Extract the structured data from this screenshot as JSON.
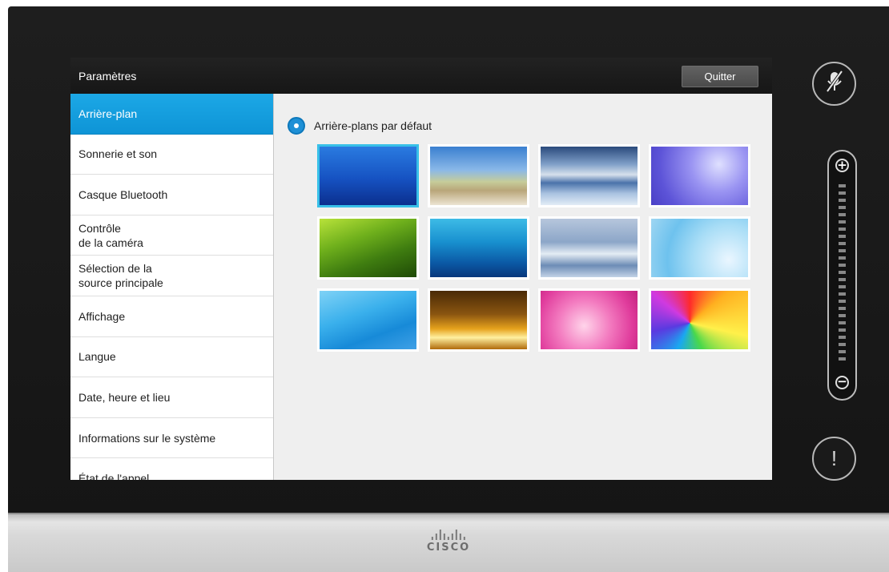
{
  "window": {
    "title": "Paramètres",
    "quit_label": "Quitter"
  },
  "sidebar": {
    "items": [
      {
        "label": "Arrière-plan",
        "active": true
      },
      {
        "label": "Sonnerie et son"
      },
      {
        "label": "Casque Bluetooth"
      },
      {
        "label": "Contrôle\nde la caméra"
      },
      {
        "label": "Sélection de la\nsource principale"
      },
      {
        "label": "Affichage"
      },
      {
        "label": "Langue"
      },
      {
        "label": "Date, heure et lieu"
      },
      {
        "label": "Informations sur le système"
      },
      {
        "label": "État de l'appel"
      }
    ]
  },
  "content": {
    "radio_label": "Arrière-plans par défaut",
    "wallpapers": [
      {
        "name": "blue-gradient",
        "selected": true
      },
      {
        "name": "beach-dunes"
      },
      {
        "name": "cloudy-sea"
      },
      {
        "name": "purple-dandelion"
      },
      {
        "name": "green-field"
      },
      {
        "name": "underwater-blue"
      },
      {
        "name": "frost-bokeh"
      },
      {
        "name": "light-blue-ripples"
      },
      {
        "name": "sky-blue-curves"
      },
      {
        "name": "golden-light"
      },
      {
        "name": "pink-floral"
      },
      {
        "name": "rainbow-burst"
      }
    ]
  },
  "controls": {
    "mute_icon": "microphone-muted-icon",
    "alert_glyph": "!",
    "volume_plus": "+",
    "volume_minus": "−",
    "volume_ticks": 13
  },
  "brand": {
    "logo_text": "CISCO"
  }
}
